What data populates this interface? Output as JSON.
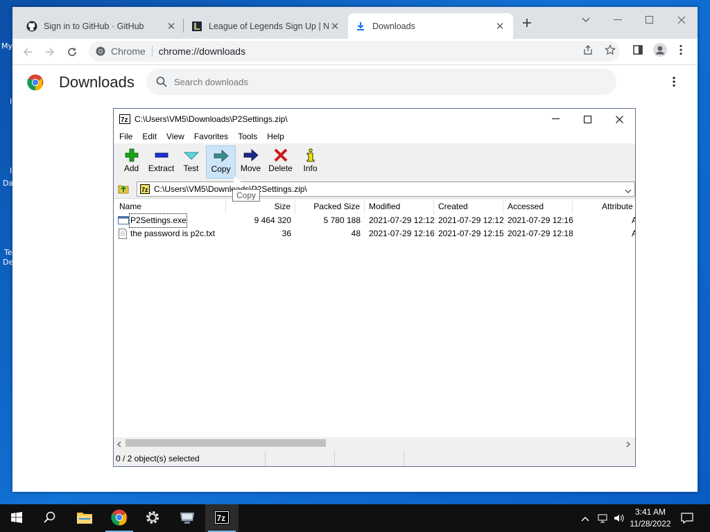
{
  "desktop": {
    "labels": [
      "My",
      "I",
      "I",
      "Da",
      "Te",
      "De"
    ]
  },
  "chrome": {
    "tabs": [
      {
        "title": "Sign in to GitHub · GitHub",
        "icon": "github-icon"
      },
      {
        "title": "League of Legends Sign Up | No",
        "icon": "league-icon"
      },
      {
        "title": "Downloads",
        "icon": "download-icon",
        "active": true
      }
    ],
    "omnibox": {
      "site": "Chrome",
      "url": "chrome://downloads"
    }
  },
  "downloads": {
    "title": "Downloads",
    "search_placeholder": "Search downloads"
  },
  "zip": {
    "title": "C:\\Users\\VM5\\Downloads\\P2Settings.zip\\",
    "menu": [
      "File",
      "Edit",
      "View",
      "Favorites",
      "Tools",
      "Help"
    ],
    "tools": [
      {
        "label": "Add",
        "icon": "plus-icon",
        "color": "#1aa31a"
      },
      {
        "label": "Extract",
        "icon": "minus-icon",
        "color": "#1f2fcf"
      },
      {
        "label": "Test",
        "icon": "check-icon",
        "color": "#22b5c8"
      },
      {
        "label": "Copy",
        "icon": "copy-arrow-icon",
        "color": "#2e7d7d"
      },
      {
        "label": "Move",
        "icon": "move-arrow-icon",
        "color": "#1c2a8a"
      },
      {
        "label": "Delete",
        "icon": "x-icon",
        "color": "#d01818"
      },
      {
        "label": "Info",
        "icon": "info-icon",
        "color": "#222222"
      }
    ],
    "address": "C:\\Users\\VM5\\Downloads\\P2Settings.zip\\",
    "columns": [
      "Name",
      "Size",
      "Packed Size",
      "Modified",
      "Created",
      "Accessed",
      "Attribute"
    ],
    "rows": [
      {
        "name": "P2Settings.exe",
        "size": "9 464 320",
        "packed": "5 780 188",
        "modified": "2021-07-29 12:12",
        "created": "2021-07-29 12:12",
        "accessed": "2021-07-29 12:16",
        "attr": "A"
      },
      {
        "name": "the password is p2c.txt",
        "size": "36",
        "packed": "48",
        "modified": "2021-07-29 12:16",
        "created": "2021-07-29 12:15",
        "accessed": "2021-07-29 12:18",
        "attr": "A"
      }
    ],
    "status": "0 / 2 object(s) selected",
    "tooltip": "Copy"
  },
  "taskbar": {
    "time": "3:41 AM",
    "date": "11/28/2022"
  }
}
